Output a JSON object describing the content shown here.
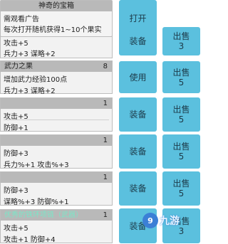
{
  "popup": {
    "title": "神奇的宝箱",
    "line1": "需观看广告",
    "line2": "每次打开随机获得1~10个果实",
    "open_label": "打开"
  },
  "cards": [
    {
      "name": "",
      "count": "",
      "stats": [
        "攻击+5",
        "兵力+3 谋略+2"
      ],
      "action_label": "装备",
      "sell_label": "出售",
      "sell_count": "3"
    },
    {
      "name": "武力之果",
      "count": "8",
      "stats": [
        "增加武力经验100点",
        "兵力+3 谋略+2"
      ],
      "action_label": "使用",
      "sell_label": "出售",
      "sell_count": "5"
    },
    {
      "name": "",
      "count": "1",
      "stats": [
        "攻击+5",
        "防御+1"
      ],
      "action_label": "装备",
      "sell_label": "出售",
      "sell_count": "5"
    },
    {
      "name": "",
      "count": "1",
      "stats": [
        "防御+3",
        "兵力%+1 攻击%+3"
      ],
      "action_label": "装备",
      "sell_label": "出售",
      "sell_count": "5"
    },
    {
      "name": "",
      "count": "1",
      "stats": [
        "防御+3",
        "谋略%+3 防御%+1"
      ],
      "action_label": "装备",
      "sell_label": "出售",
      "sell_count": "5"
    },
    {
      "name": "优秀的铁环项链（武器）",
      "count": "1",
      "stats": [
        "攻击+5",
        "攻击+1 防御+4"
      ],
      "action_label": "装备",
      "sell_label": "出售",
      "sell_count": "3"
    }
  ],
  "watermark": {
    "logo": "9",
    "text": "九游"
  }
}
